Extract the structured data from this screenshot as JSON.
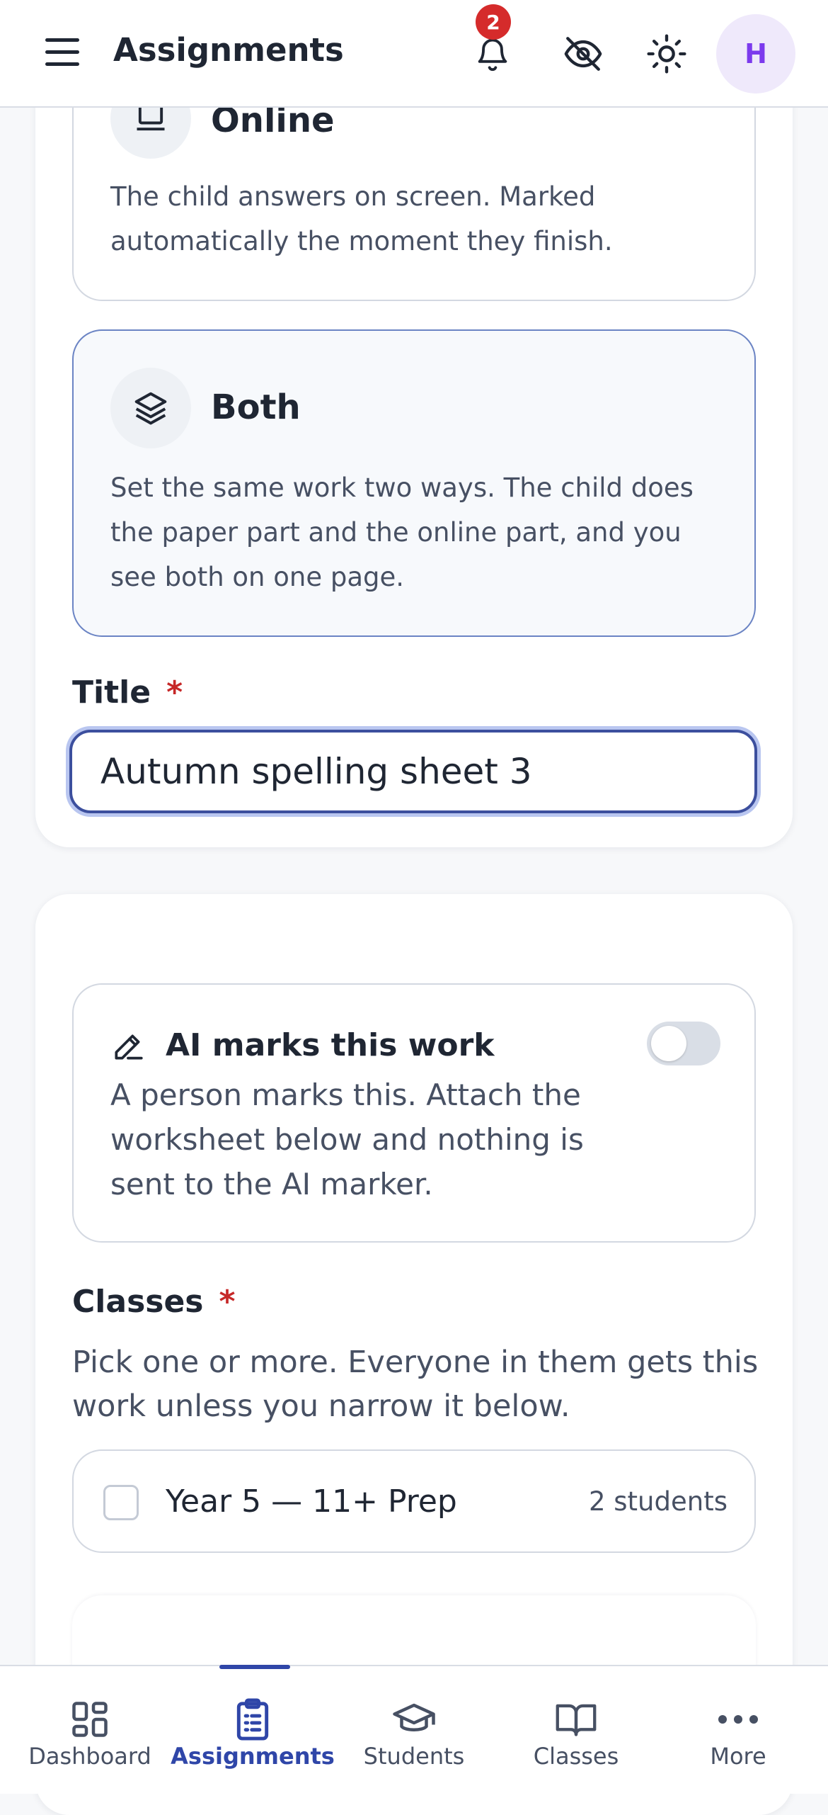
{
  "header": {
    "title": "Assignments",
    "notification_count": "2",
    "avatar_initial": "H",
    "icons": [
      "menu-icon",
      "bell-icon",
      "eye-off-icon",
      "sun-icon"
    ]
  },
  "delivery_options": [
    {
      "title": "Online",
      "description": "The child answers on screen. Marked automatically the moment they finish.",
      "icon": "laptop-icon",
      "selected": false
    },
    {
      "title": "Both",
      "description": "Set the same work two ways. The child does the paper part and the online part, and you see both on one page.",
      "icon": "layers-icon",
      "selected": true
    }
  ],
  "title_field": {
    "label": "Title",
    "required_mark": "*",
    "value": "Autumn spelling sheet 3"
  },
  "ai_marking": {
    "title": "AI marks this work",
    "description": "A person marks this. Attach the worksheet below and nothing is sent to the AI marker.",
    "enabled": false
  },
  "classes": {
    "label": "Classes",
    "required_mark": "*",
    "help": "Pick one or more. Everyone in them gets this work unless you narrow it below.",
    "items": [
      {
        "name": "Year 5 — 11+ Prep",
        "count": "2 students",
        "checked": false
      }
    ]
  },
  "bottom_nav": [
    {
      "label": "Dashboard",
      "icon": "grid-icon",
      "active": false
    },
    {
      "label": "Assignments",
      "icon": "clipboard-icon",
      "active": true
    },
    {
      "label": "Students",
      "icon": "graduation-cap-icon",
      "active": false
    },
    {
      "label": "Classes",
      "icon": "book-icon",
      "active": false
    },
    {
      "label": "More",
      "icon": "more-icon",
      "active": false
    }
  ],
  "colors": {
    "accent": "#2f46a8",
    "required": "#c62828",
    "avatar_bg": "#efe9fb",
    "avatar_text": "#7c3aed",
    "badge": "#d52b2b"
  }
}
